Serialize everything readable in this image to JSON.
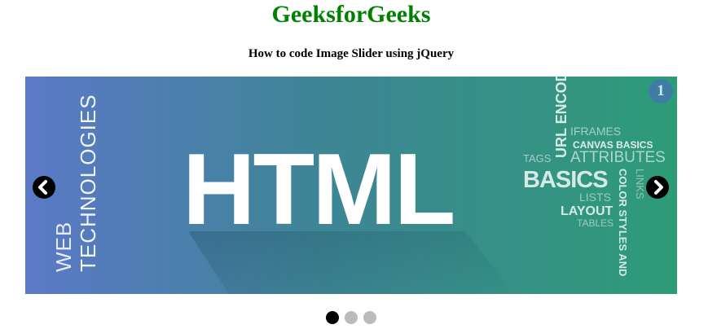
{
  "header": {
    "title": "GeeksforGeeks",
    "subtitle": "How to code Image Slider using jQuery"
  },
  "slider": {
    "current_number": "1",
    "slides": [
      {
        "headline": "HTML",
        "side_text_top": "TECHNOLOGIES",
        "side_text_bottom": "WEB",
        "word_cloud": {
          "url_encode": "URL ENCOD",
          "iframes": "IFRAMES",
          "canvas_basics": "CANVAS BASICS",
          "tags": "TAGS",
          "attributes": "ATTRIBUTES",
          "basics": "BASICS",
          "color_styles": "COLOR STYLES AND",
          "links": "LINKS",
          "lists": "LISTS",
          "layout": "LAYOUT",
          "tables": "TABLES"
        }
      }
    ],
    "prev_icon": "chevron-left-icon",
    "next_icon": "chevron-right-icon",
    "dots": [
      {
        "active": true
      },
      {
        "active": false
      },
      {
        "active": false
      }
    ]
  },
  "colors": {
    "title_green": "#008000",
    "gradient_start": "#5b79c7",
    "gradient_end": "#2e9b77",
    "dot_active": "#000000",
    "dot_inactive": "#bbbbbb"
  }
}
